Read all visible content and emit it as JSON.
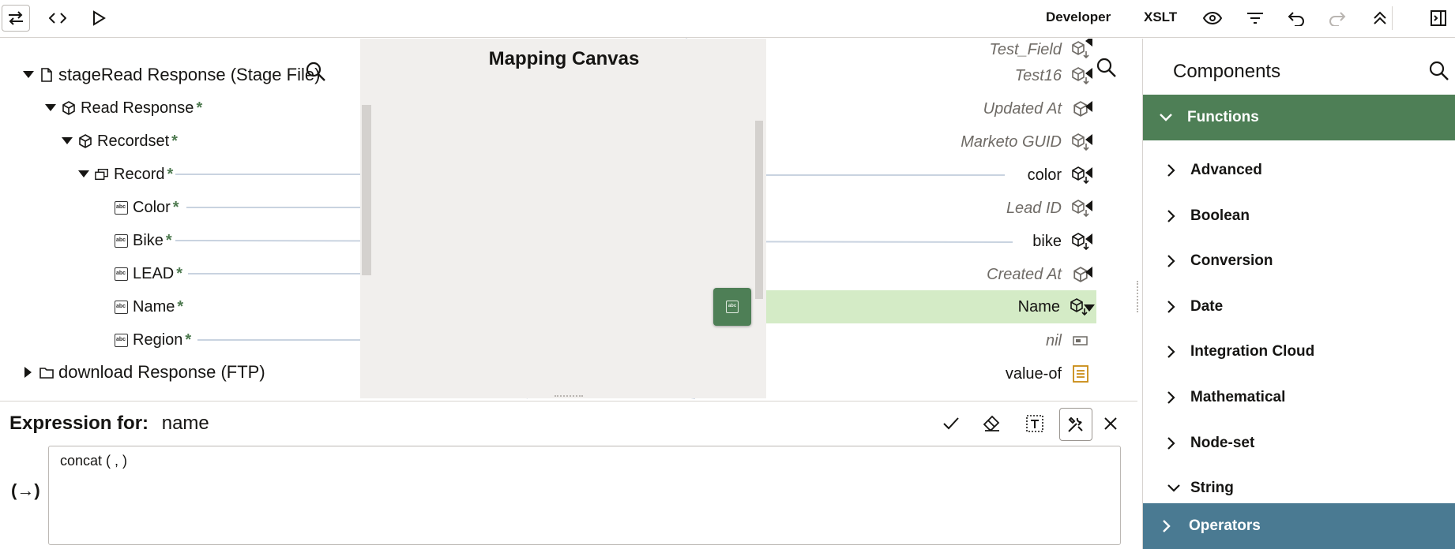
{
  "toolbar": {
    "mode_developer": "Developer",
    "mode_xslt": "XSLT",
    "icons": [
      "swap-icon",
      "code-icon",
      "play-icon",
      "eye-icon",
      "filter-icon",
      "undo-icon",
      "redo-icon",
      "collapse-all-icon",
      "panel-toggle-icon"
    ]
  },
  "source": {
    "root": "stageRead Response (Stage File)",
    "read_response": "Read Response",
    "recordset": "Recordset",
    "record": "Record",
    "fields": [
      "Color",
      "Bike",
      "LEAD",
      "Name",
      "Region"
    ],
    "required_mark": "*",
    "download": "download Response (FTP)"
  },
  "canvas": {
    "title": "Mapping Canvas",
    "function_badge": "abc"
  },
  "target": {
    "rows": [
      {
        "label": "Test_Field",
        "optional": true
      },
      {
        "label": "Test16",
        "optional": true
      },
      {
        "label": "Updated At",
        "optional": true
      },
      {
        "label": "Marketo GUID",
        "optional": true
      },
      {
        "label": "color",
        "optional": false
      },
      {
        "label": "Lead ID",
        "optional": true
      },
      {
        "label": "bike",
        "optional": false
      },
      {
        "label": "Created At",
        "optional": true
      },
      {
        "label": "Name",
        "optional": false
      },
      {
        "label": "nil",
        "optional": true
      },
      {
        "label": "value-of",
        "optional": false
      }
    ]
  },
  "components": {
    "title": "Components",
    "functions_header": "Functions",
    "items": [
      "Advanced",
      "Boolean",
      "Conversion",
      "Date",
      "Integration Cloud",
      "Mathematical",
      "Node-set",
      "String"
    ],
    "operators_header": "Operators",
    "colors": {
      "functions": "#4e7f56",
      "operators": "#4a7a92"
    }
  },
  "expression": {
    "label": "Expression for:",
    "target": "name",
    "value": "concat ( , )",
    "side_label": "(→)"
  }
}
